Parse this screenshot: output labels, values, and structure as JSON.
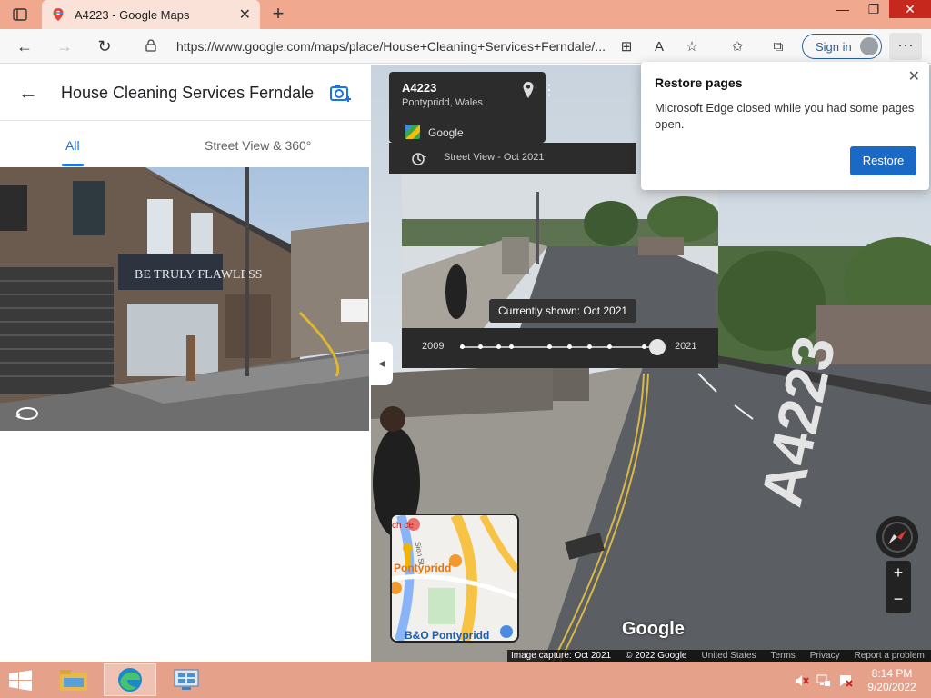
{
  "browser": {
    "tab_title": "A4223 - Google Maps",
    "url": "https://www.google.com/maps/place/House+Cleaning+Services+Ferndale/...",
    "sign_in": "Sign in"
  },
  "left_panel": {
    "title": "House Cleaning Services Ferndale",
    "tabs": [
      {
        "label": "All",
        "active": true
      },
      {
        "label": "Street View & 360°",
        "active": false
      }
    ],
    "shop_sign": "BE TRULY FLAWLESS"
  },
  "streetview": {
    "location_title": "A4223",
    "location_sub": "Pontypridd, Wales",
    "provider": "Google",
    "timeline_label": "Street View - Oct 2021",
    "currently_shown": "Currently shown: Oct 2021",
    "year_start": "2009",
    "year_end": "2021",
    "road_marking": "A4223",
    "watermark": "Google",
    "footer": {
      "capture": "Image capture: Oct 2021",
      "copyright": "© 2022 Google",
      "country": "United States",
      "terms": "Terms",
      "privacy": "Privacy",
      "report": "Report a problem"
    },
    "minimap": {
      "label_store": "B&O Pontypridd",
      "label_pont": "Pontypridd",
      "label_street": "Sion St",
      "label_partial": "ch ce"
    }
  },
  "popup": {
    "title": "Restore pages",
    "message": "Microsoft Edge closed while you had some pages open.",
    "button": "Restore"
  },
  "taskbar": {
    "time": "8:14 PM",
    "date": "9/20/2022"
  },
  "colors": {
    "accent": "#1a73e8",
    "titlebar": "#f0a88f",
    "taskbar": "#e6a18b",
    "restore_button": "#1a69c4"
  }
}
